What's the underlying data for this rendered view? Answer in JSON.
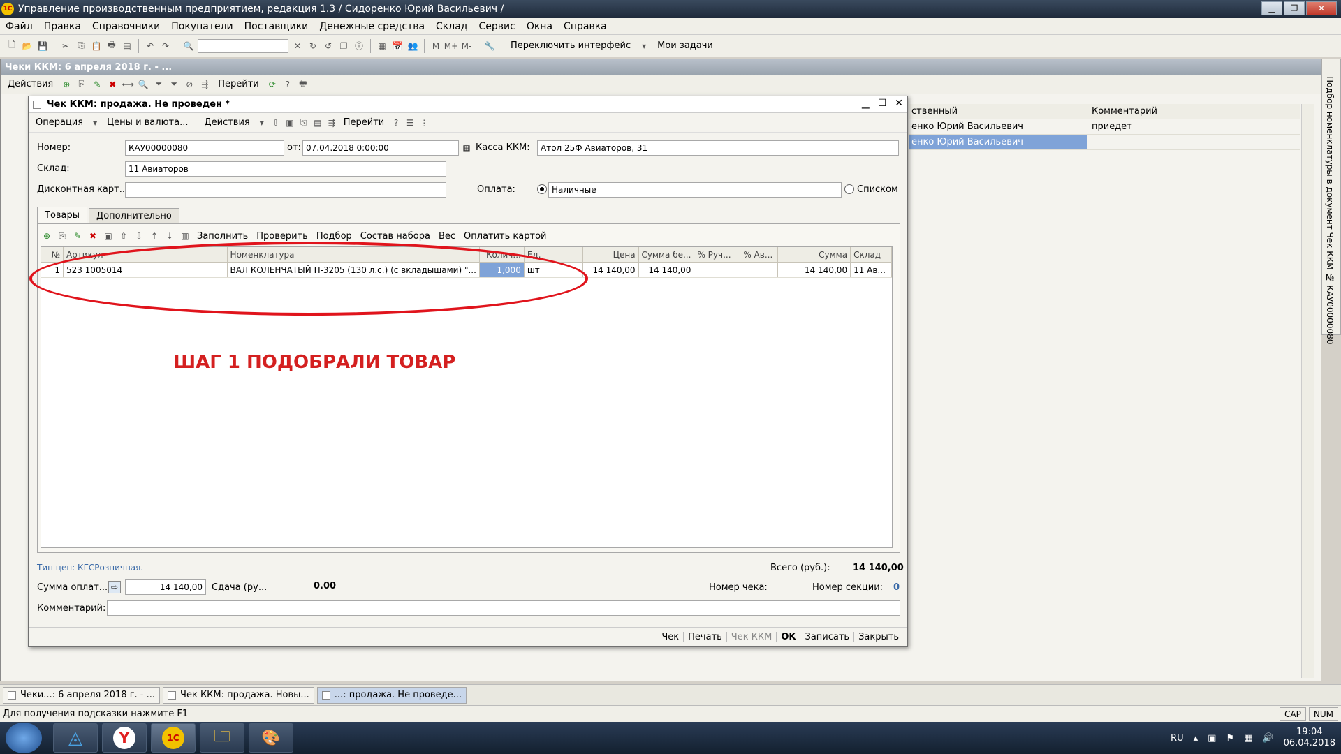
{
  "window": {
    "title": "Управление производственным предприятием, редакция 1.3 / Сидоренко Юрий Васильевич /"
  },
  "menu": [
    "Файл",
    "Правка",
    "Справочники",
    "Покупатели",
    "Поставщики",
    "Денежные средства",
    "Склад",
    "Сервис",
    "Окна",
    "Справка"
  ],
  "main_toolbar": {
    "switch_interface": "Переключить интерфейс",
    "my_tasks": "Мои задачи"
  },
  "bg_window": {
    "title": "Чеки ККМ: 6 апреля 2018 г. - ...",
    "actions": "Действия",
    "goto": "Перейти",
    "grid": {
      "col1": "ственный",
      "col2": "Комментарий",
      "rows": [
        {
          "c1": "енко Юрий Васильевич",
          "c2": "приедет"
        },
        {
          "c1": "енко Юрий Васильевич",
          "c2": ""
        }
      ]
    }
  },
  "right_panel": {
    "label": "Подбор номенклатуры в документ Чек ККМ № КАУ00000080"
  },
  "dialog": {
    "title": "Чек ККМ: продажа. Не проведен *",
    "toolbar": {
      "operation": "Операция",
      "prices": "Цены и валюта...",
      "actions": "Действия",
      "goto": "Перейти"
    },
    "fields": {
      "number_label": "Номер:",
      "number_value": "КАУ00000080",
      "date_label": "от:",
      "date_value": "07.04.2018  0:00:00",
      "kassa_label": "Касса ККМ:",
      "kassa_value": "Атол 25Ф Авиаторов, 31",
      "sklad_label": "Склад:",
      "sklad_value": "11 Авиаторов",
      "discount_label": "Дисконтная карт...",
      "discount_value": "",
      "payment_label": "Оплата:",
      "payment_cash": "Наличные",
      "payment_list": "Списком"
    },
    "tabs": [
      "Товары",
      "Дополнительно"
    ],
    "grid_toolbar": {
      "fill": "Заполнить",
      "check": "Проверить",
      "pick": "Подбор",
      "kit": "Состав набора",
      "weight": "Вес",
      "pay_card": "Оплатить картой"
    },
    "grid": {
      "headers": [
        "№",
        "Артикул",
        "Номенклатура",
        "Колич...",
        "Ед.",
        "Цена",
        "Сумма бе...",
        "% Руч...",
        "% Ав...",
        "Сумма",
        "Склад"
      ],
      "rows": [
        {
          "n": "1",
          "article": "523 1005014",
          "name": "ВАЛ КОЛЕНЧАТЫЙ П-3205 (130 л.с.) (с вкладышами) \"...",
          "qty": "1,000",
          "unit": "шт",
          "price": "14 140,00",
          "sum_wo": "14 140,00",
          "pct_manual": "",
          "pct_auto": "",
          "sum": "14 140,00",
          "sklad": "11 Ав..."
        }
      ]
    },
    "annotation": "ШАГ 1 ПОДОБРАЛИ ТОВАР",
    "footer": {
      "price_type": "Тип цен: КГСРозничная.",
      "total_label": "Всего (руб.):",
      "total_value": "14 140,00",
      "paid_label": "Сумма оплат...",
      "paid_value": "14 140,00",
      "change_label": "Сдача (ру...",
      "change_value": "0.00",
      "check_no_label": "Номер чека:",
      "section_label": "Номер секции:",
      "section_value": "0",
      "comment_label": "Комментарий:",
      "comment_value": ""
    },
    "bottom_buttons": [
      "Чек",
      "Печать",
      "Чек ККМ",
      "OK",
      "Записать",
      "Закрыть"
    ]
  },
  "task_strip": [
    {
      "label": "Чеки...: 6 апреля 2018 г. - ..."
    },
    {
      "label": "Чек ККМ: продажа. Новы..."
    },
    {
      "label": "...: продажа. Не проведе..."
    }
  ],
  "status": {
    "hint": "Для получения подсказки нажмите F1",
    "cap": "CAP",
    "num": "NUM"
  },
  "taskbar": {
    "lang": "RU",
    "time": "19:04",
    "date": "06.04.2018"
  },
  "colors": {
    "selection": "#7fa3d8",
    "annotation": "#d42020",
    "link": "#3a6aa8"
  }
}
